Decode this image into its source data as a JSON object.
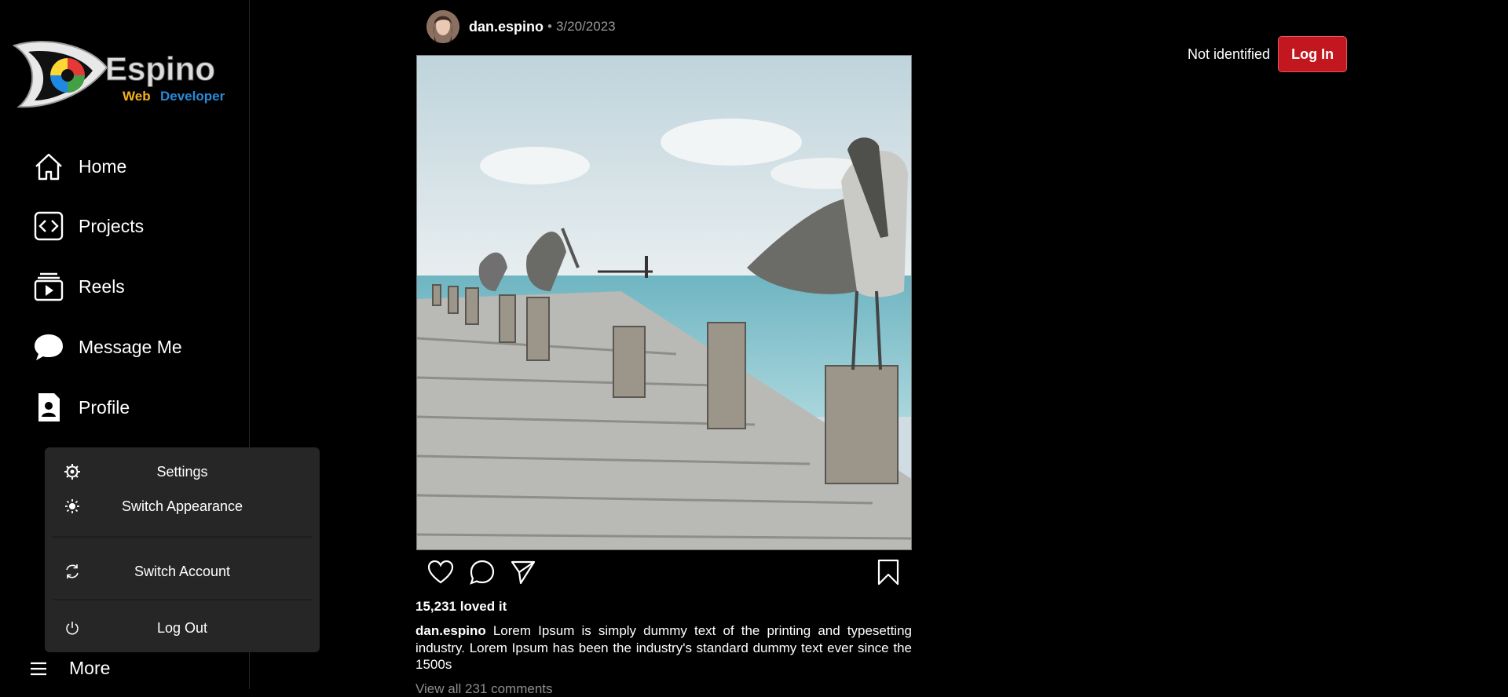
{
  "brand": {
    "logo_main": "Espino",
    "logo_sub1": "Web",
    "logo_sub2": "Developer"
  },
  "nav": [
    {
      "label": "Home",
      "icon": "home-icon"
    },
    {
      "label": "Projects",
      "icon": "code-icon"
    },
    {
      "label": "Reels",
      "icon": "reels-icon"
    },
    {
      "label": "Message Me",
      "icon": "chat-bubble-icon"
    },
    {
      "label": "Profile",
      "icon": "profile-icon"
    }
  ],
  "menu": {
    "settings": "Settings",
    "appearance": "Switch Appearance",
    "switch_account": "Switch Account",
    "logout": "Log Out"
  },
  "more_label": "More",
  "post": {
    "username": "dan.espino",
    "separator": "•",
    "date": "3/20/2023",
    "likes": "15,231 loved it",
    "caption_user": "dan.espino",
    "caption_text": "Lorem Ipsum is simply dummy text of the printing and typesetting industry. Lorem Ipsum has been the industry's standard dummy text ever since the 1500s",
    "comments_link": "View all 231 comments"
  },
  "auth": {
    "status": "Not identified",
    "login_label": "Log In"
  },
  "colors": {
    "accent": "#c3171f",
    "background": "#000000",
    "menu_bg": "#262626"
  }
}
